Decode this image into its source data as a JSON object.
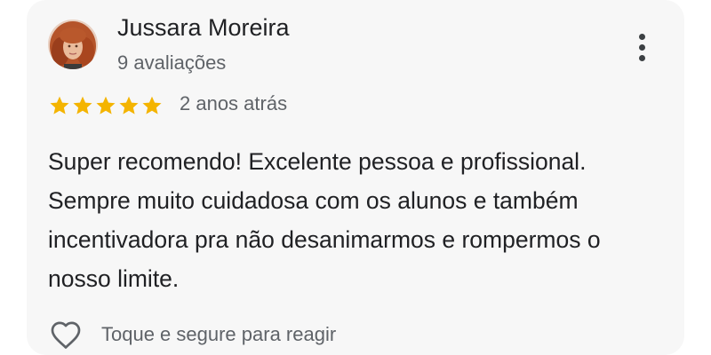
{
  "review": {
    "author_name": "Jussara Moreira",
    "review_count": "9 avaliações",
    "rating": 5,
    "max_rating": 5,
    "date": "2 anos atrás",
    "text": "Super recomendo! Excelente pessoa e profissional. Sempre muito cuidadosa com os alunos e também incentivadora pra não desanimarmos e rompermos o nosso limite.",
    "react_hint": "Toque e segure para reagir"
  },
  "icons": {
    "avatar": "profile-photo",
    "menu": "more-vert-icon",
    "star": "star-icon",
    "react": "heart-outline-icon"
  },
  "colors": {
    "card_background": "#f7f7f7",
    "star": "#f4b400",
    "primary_text": "#202124",
    "secondary_text": "#5f6368"
  }
}
